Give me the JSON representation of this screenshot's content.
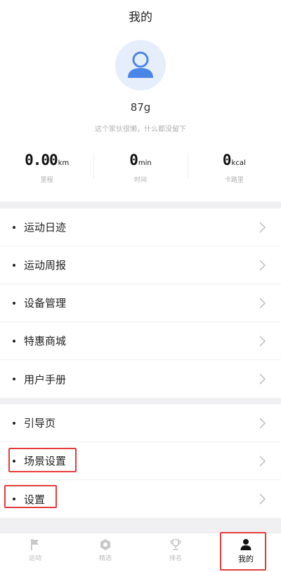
{
  "header": {
    "title": "我的",
    "username": "87g",
    "signature": "这个家伙很懒，什么都没留下"
  },
  "stats": [
    {
      "value": "0.00",
      "unit": "km",
      "label": "里程"
    },
    {
      "value": "0",
      "unit": "min",
      "label": "时间"
    },
    {
      "value": "0",
      "unit": "kcal",
      "label": "卡路里"
    }
  ],
  "menu_group_1": [
    {
      "label": "运动日迹"
    },
    {
      "label": "运动周报"
    },
    {
      "label": "设备管理"
    },
    {
      "label": "特惠商城"
    },
    {
      "label": "用户手册"
    }
  ],
  "menu_group_2": [
    {
      "label": "引导页"
    },
    {
      "label": "场景设置"
    },
    {
      "label": "设置"
    }
  ],
  "tabbar": [
    {
      "label": "运动",
      "icon": "flag-icon",
      "active": false
    },
    {
      "label": "精选",
      "icon": "hexagon-icon",
      "active": false
    },
    {
      "label": "排名",
      "icon": "trophy-icon",
      "active": false
    },
    {
      "label": "我的",
      "icon": "person-icon",
      "active": true
    }
  ],
  "colors": {
    "accent": "#4a86e8",
    "avatar_bg": "#e6eefb",
    "highlight": "#e53b3b"
  }
}
